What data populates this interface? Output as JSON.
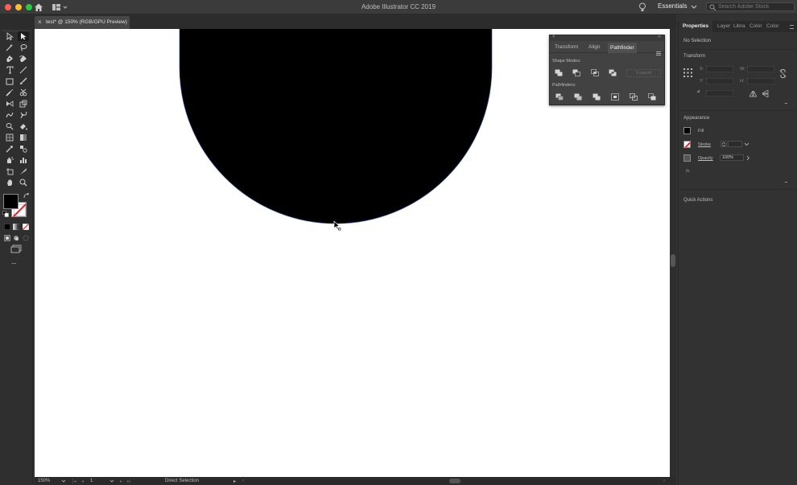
{
  "window": {
    "title": "Adobe Illustrator CC 2019",
    "workspace": "Essentials",
    "search_placeholder": "Search Adobe Stock"
  },
  "document_tab": {
    "close": "×",
    "name": "test* @ 150% (RGB/GPU Preview)"
  },
  "tools": {
    "more": "..."
  },
  "pathfinder_panel": {
    "close": "×",
    "collapse": "‹‹",
    "tabs": [
      {
        "label": "Transform",
        "active": false
      },
      {
        "label": "Align",
        "active": false
      },
      {
        "label": "Pathfinder",
        "active": true
      }
    ],
    "shape_modes_label": "Shape Modes:",
    "expand_label": "Expand",
    "pathfinders_label": "Pathfinders:"
  },
  "properties_panel": {
    "tabs": [
      {
        "label": "Properties",
        "active": true
      },
      {
        "label": "Layer",
        "active": false
      },
      {
        "label": "Libra",
        "active": false
      },
      {
        "label": "Color",
        "active": false
      },
      {
        "label": "Color",
        "active": false
      }
    ],
    "no_selection": "No Selection",
    "transform_title": "Transform",
    "transform_fields": {
      "x": "X:",
      "y": "Y:",
      "w": "W:",
      "h": "H:",
      "angle": "⊿"
    },
    "appearance_title": "Appearance",
    "fill_label": "Fill",
    "stroke_label": "Stroke",
    "opacity_label": "Opacity",
    "opacity_value": "100%",
    "fx_label": "fx.",
    "quick_actions_title": "Quick Actions",
    "more": "..."
  },
  "status_bar": {
    "zoom": "150%",
    "artboard": "1",
    "tool": "Direct Selection"
  },
  "colors": {
    "fill": "#000000",
    "stroke_none": "#e0242a",
    "canvas": "#ffffff",
    "ui_dark": "#323232"
  },
  "icons": [
    "home-icon",
    "workspace-switcher-icon",
    "lightbulb-icon",
    "search-icon",
    "selection-tool-icon",
    "direct-selection-tool-icon",
    "magic-wand-icon",
    "lasso-icon",
    "pen-tool-icon",
    "curvature-tool-icon",
    "type-tool-icon",
    "line-tool-icon",
    "rectangle-tool-icon",
    "paintbrush-icon",
    "shaper-tool-icon",
    "eraser-icon",
    "rotate-tool-icon",
    "scale-tool-icon",
    "warp-tool-icon",
    "puppet-warp-icon",
    "shape-builder-icon",
    "live-paint-icon",
    "perspective-grid-icon",
    "mesh-tool-icon",
    "eyedropper-icon",
    "blend-tool-icon",
    "symbol-sprayer-icon",
    "graph-tool-icon",
    "artboard-tool-icon",
    "slice-tool-icon",
    "hand-tool-icon",
    "zoom-tool-icon"
  ]
}
